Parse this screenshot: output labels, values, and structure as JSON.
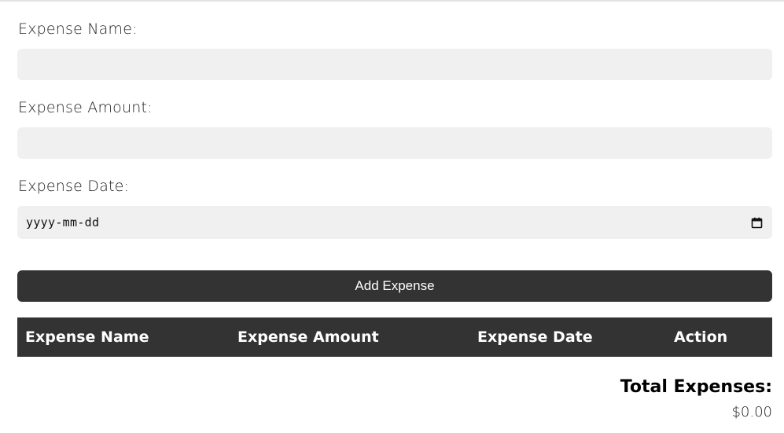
{
  "form": {
    "name_label": "Expense Name:",
    "name_value": "",
    "amount_label": "Expense Amount:",
    "amount_value": "",
    "date_label": "Expense Date:",
    "date_placeholder": "yyyy-mm-dd",
    "date_icon": "calendar-icon",
    "add_button_label": "Add Expense"
  },
  "table": {
    "headers": [
      "Expense Name",
      "Expense Amount",
      "Expense Date",
      "Action"
    ],
    "rows": []
  },
  "total": {
    "label": "Total Expenses:",
    "value": "$0.00"
  },
  "colors": {
    "dark": "#333333",
    "input_bg": "#f0f0f0"
  }
}
